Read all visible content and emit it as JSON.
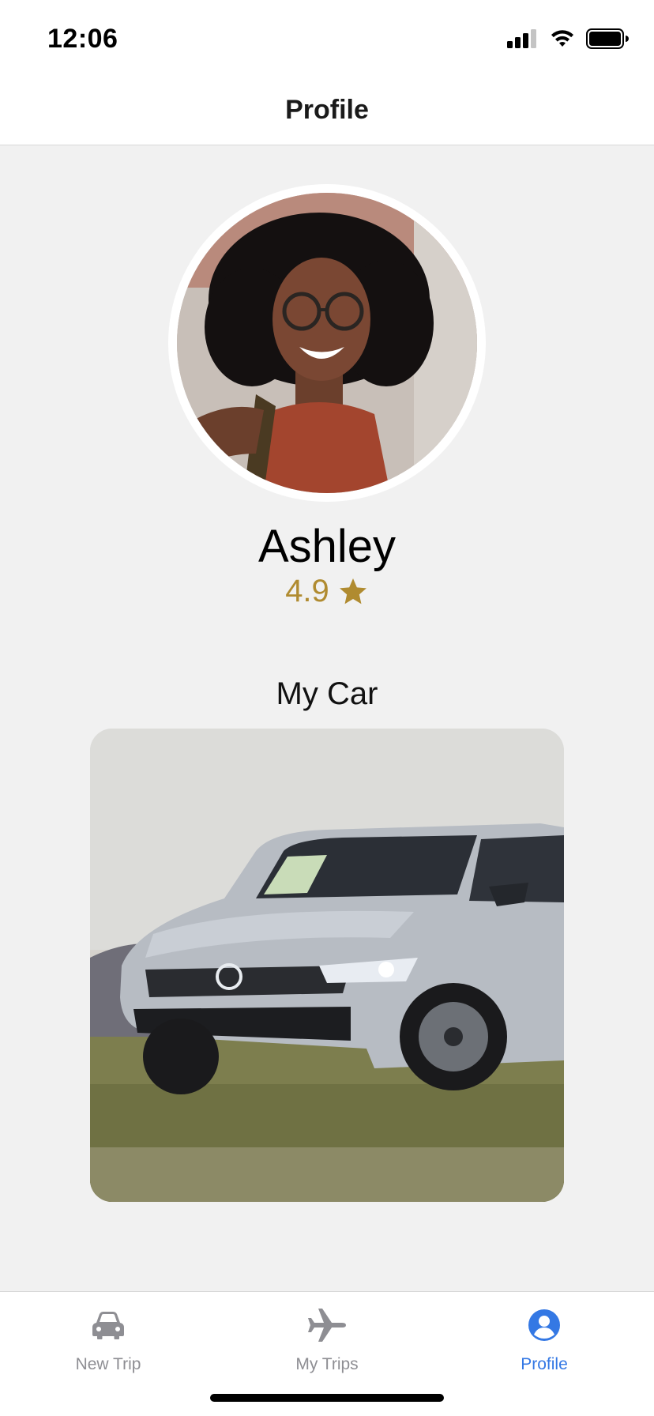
{
  "status_bar": {
    "time": "12:06"
  },
  "header": {
    "title": "Profile"
  },
  "profile": {
    "name": "Ashley",
    "rating": "4.9"
  },
  "car_section": {
    "title": "My Car"
  },
  "tabs": [
    {
      "label": "New Trip",
      "icon": "car-icon",
      "active": false
    },
    {
      "label": "My Trips",
      "icon": "airplane-icon",
      "active": false
    },
    {
      "label": "Profile",
      "icon": "person-circle-icon",
      "active": true
    }
  ],
  "colors": {
    "accent": "#3478e4",
    "rating": "#b08b30",
    "inactive": "#8e8e93",
    "background": "#f1f1f1"
  }
}
